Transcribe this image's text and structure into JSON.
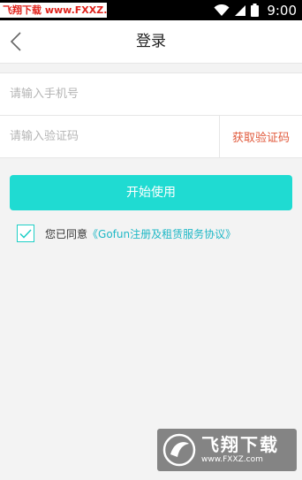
{
  "status_bar": {
    "watermark": "飞翔下载 www.FXXZ.com",
    "time": "9:00",
    "icons": [
      "wifi-icon",
      "signal-icon",
      "battery-icon"
    ]
  },
  "nav": {
    "title": "登录",
    "back_icon": "chevron-left-icon"
  },
  "form": {
    "phone_placeholder": "请输入手机号",
    "code_placeholder": "请输入验证码",
    "get_code_label": "获取验证码"
  },
  "start_button": {
    "label": "开始使用"
  },
  "agreement": {
    "checked": true,
    "prefix": "您已同意",
    "link": "《Gofun注册及租赁服务协议》"
  },
  "watermark_bottom": {
    "name": "飞翔下载",
    "url": "www.FXXZ.com"
  },
  "colors": {
    "accent": "#1fdbd2",
    "link": "#1fb8c6",
    "code_button": "#e15a3c",
    "background": "#f3f3f3"
  }
}
